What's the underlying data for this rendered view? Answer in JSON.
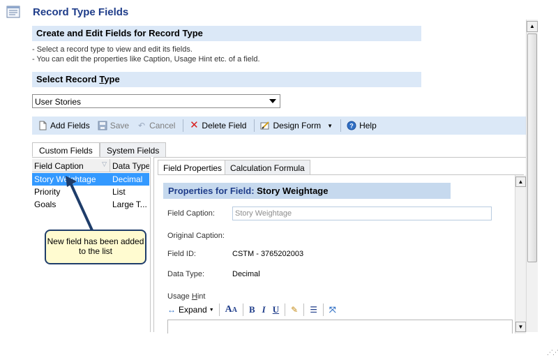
{
  "header": {
    "title": "Record Type Fields"
  },
  "sections": {
    "create_title": "Create and Edit Fields for Record Type",
    "instructions": [
      "-   Select a record type to view and edit its fields.",
      "-   You can edit the properties like Caption, Usage Hint etc. of a field."
    ],
    "select_title_prefix": "Select Record ",
    "select_title_ul": "T",
    "select_title_suffix": "ype"
  },
  "record_type_select": {
    "value": "User Stories"
  },
  "toolbar": {
    "add_fields": "Add Fields",
    "save": "Save",
    "cancel": "Cancel",
    "delete_field": "Delete Field",
    "design_form": "Design Form",
    "help": "Help"
  },
  "left_tabs": {
    "custom": "Custom Fields",
    "system": "System Fields"
  },
  "fields_table": {
    "columns": [
      "Field Caption",
      "Data Type"
    ],
    "rows": [
      {
        "caption": "Story Weightage",
        "type": "Decimal",
        "selected": true
      },
      {
        "caption": "Priority",
        "type": "List",
        "selected": false
      },
      {
        "caption": "Goals",
        "type": "Large T...",
        "selected": false
      }
    ]
  },
  "right_tabs": {
    "field_properties": "Field Properties",
    "calculation_formula": "Calculation Formula"
  },
  "properties": {
    "bar_label": "Properties for Field: ",
    "bar_value": "Story Weightage",
    "caption_label": "Field Caption:",
    "caption_value": "Story Weightage",
    "original_caption_label": "Original Caption:",
    "field_id_label": "Field ID:",
    "field_id_value": "CSTM - 3765202003",
    "data_type_label": "Data Type:",
    "data_type_value": "Decimal",
    "usage_hint_label_prefix": "Usage ",
    "usage_hint_label_ul": "H",
    "usage_hint_label_suffix": "int"
  },
  "editor_toolbar": {
    "expand": "Expand"
  },
  "callout": {
    "text": "New field has been added to the list"
  },
  "colors": {
    "accent": "#1f3d8a",
    "section_bg": "#dbe8f7",
    "selected_row": "#3399ff",
    "callout_bg": "#fffbd0"
  }
}
